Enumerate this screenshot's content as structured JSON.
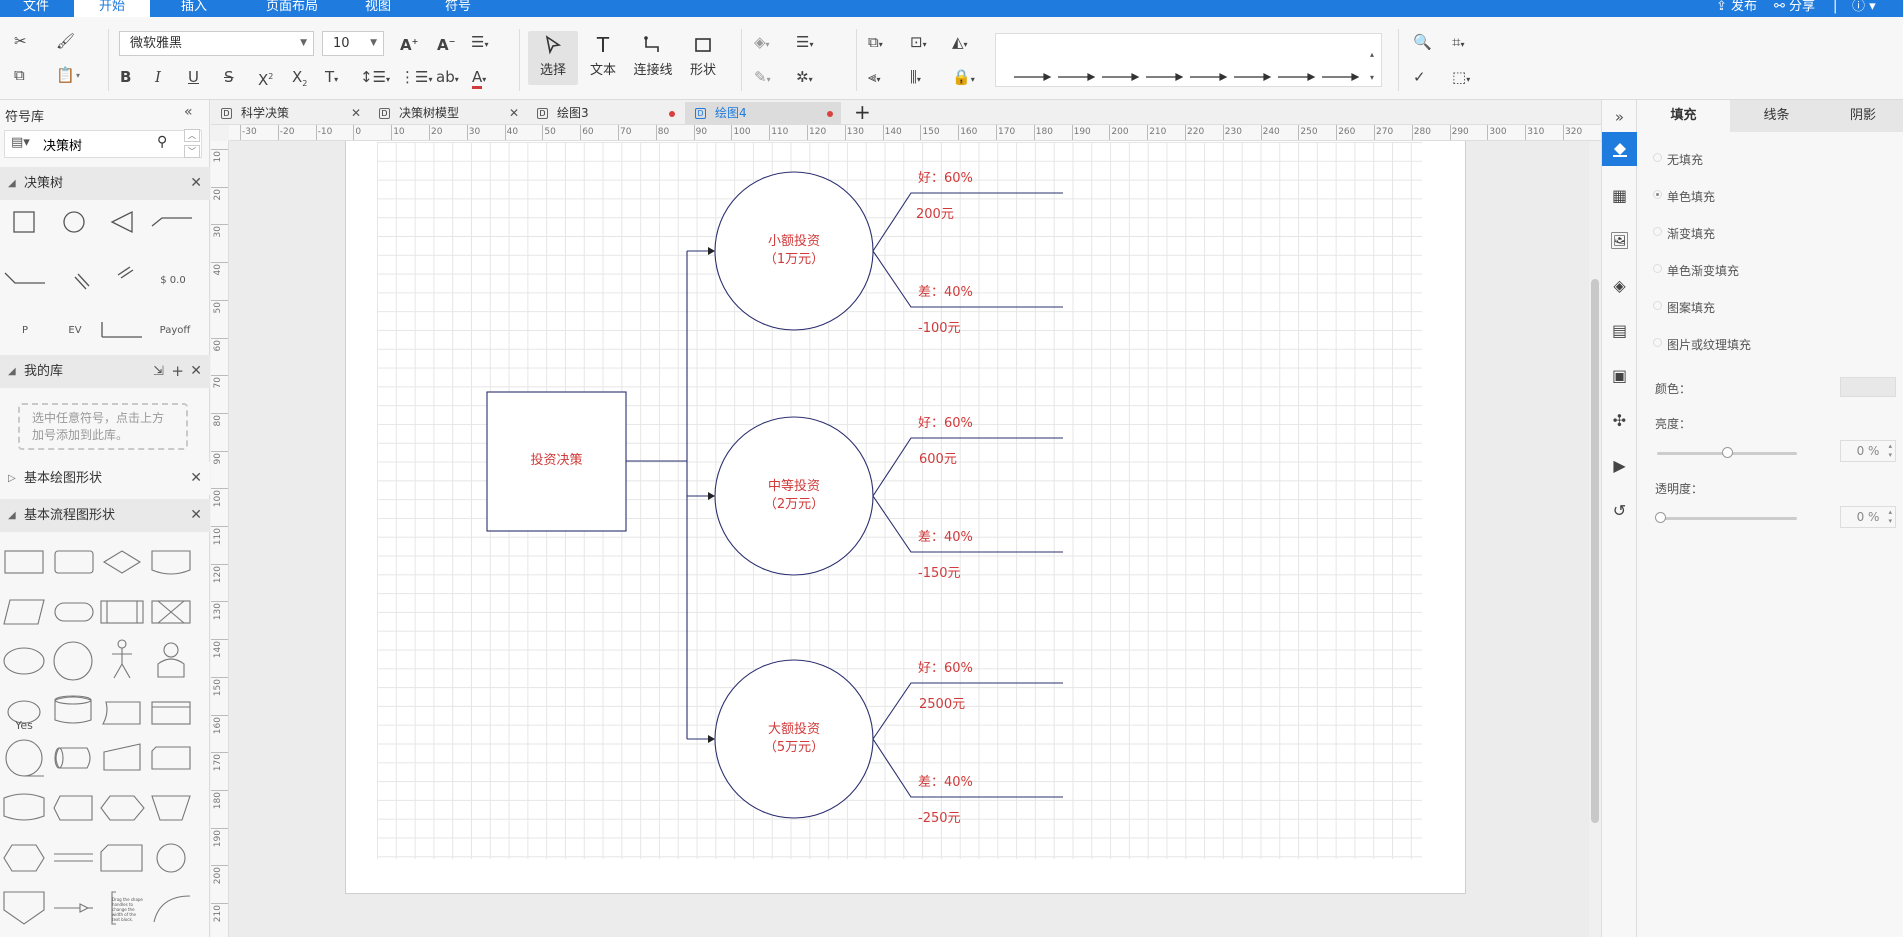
{
  "menu": {
    "items": [
      "文件",
      "开始",
      "插入",
      "页面布局",
      "视图",
      "符号"
    ],
    "right": [
      "发布",
      "分享"
    ]
  },
  "ribbon": {
    "font_name": "微软雅黑",
    "font_size": "10",
    "tools": {
      "select": "选择",
      "text": "文本",
      "connector": "连接线",
      "shape": "形状"
    }
  },
  "left_panel": {
    "title": "符号库",
    "search_value": "决策树",
    "section_decision_tree": "决策树",
    "decision_shapes": [
      "$ 0.0",
      "P",
      "EV",
      "Payoff"
    ],
    "section_my_library": "我的库",
    "my_library_hint": "选中任意符号，点击上方加号添加到此库。",
    "section_basic_drawing": "基本绘图形状",
    "section_basic_flowchart": "基本流程图形状",
    "flow_yes": "Yes",
    "flow_note": "Drag the shape handles to change the width of the text block."
  },
  "tabs": [
    {
      "label": "科学决策",
      "state": "close"
    },
    {
      "label": "决策树模型",
      "state": "close"
    },
    {
      "label": "绘图3",
      "state": "unsaved"
    },
    {
      "label": "绘图4",
      "state": "unsaved",
      "active": true
    }
  ],
  "ruler": {
    "h_ticks": [
      "-30",
      "-20",
      "-10",
      "0",
      "10",
      "20",
      "30",
      "40",
      "50",
      "60",
      "70",
      "80",
      "90",
      "100",
      "110",
      "120",
      "130",
      "140",
      "150",
      "160",
      "170",
      "180",
      "190",
      "200",
      "210",
      "220",
      "230",
      "240",
      "250",
      "260",
      "270",
      "280",
      "290",
      "300",
      "310",
      "320"
    ],
    "v_ticks": [
      "10",
      "20",
      "30",
      "40",
      "50",
      "60",
      "70",
      "80",
      "90",
      "100",
      "110",
      "120",
      "130",
      "140",
      "150",
      "160",
      "170",
      "180",
      "190",
      "200",
      "210"
    ]
  },
  "diagram": {
    "root": "投资决策",
    "nodes": [
      {
        "line1": "小额投资",
        "line2": "（1万元）",
        "good": "好：60%",
        "good_value": "200元",
        "bad": "差：40%",
        "bad_value": "-100元"
      },
      {
        "line1": "中等投资",
        "line2": "（2万元）",
        "good": "好：60%",
        "good_value": "600元",
        "bad": "差：40%",
        "bad_value": "-150元"
      },
      {
        "line1": "大额投资",
        "line2": "（5万元）",
        "good": "好：60%",
        "good_value": "2500元",
        "bad": "差：40%",
        "bad_value": "-250元"
      }
    ],
    "colors": {
      "text": "#d03a3a",
      "stroke": "#2b2f6e"
    }
  },
  "properties": {
    "tabs": [
      "填充",
      "线条",
      "阴影"
    ],
    "fill_options": [
      "无填充",
      "单色填充",
      "渐变填充",
      "单色渐变填充",
      "图案填充",
      "图片或纹理填充"
    ],
    "selected_fill": 1,
    "color_label": "颜色：",
    "brightness_label": "亮度：",
    "brightness_value": "0 %",
    "transparency_label": "透明度：",
    "transparency_value": "0 %"
  },
  "colors": {
    "accent": "#1f7bde"
  }
}
